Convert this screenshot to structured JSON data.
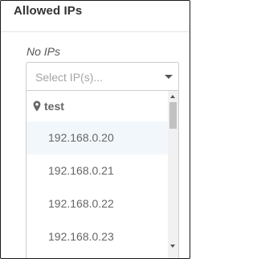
{
  "panel": {
    "title": "Allowed IPs",
    "empty_label": "No IPs"
  },
  "select": {
    "placeholder": "Select IP(s)...",
    "caret_icon": "chevron-down-icon"
  },
  "dropdown": {
    "group": {
      "icon": "map-pin-icon",
      "label": "test"
    },
    "options": [
      {
        "label": "192.168.0.20",
        "highlighted": true
      },
      {
        "label": "192.168.0.21",
        "highlighted": false
      },
      {
        "label": "192.168.0.22",
        "highlighted": false
      },
      {
        "label": "192.168.0.23",
        "highlighted": false
      }
    ]
  },
  "colors": {
    "highlight_bg": "#f2f7fb",
    "text": "#666666",
    "placeholder": "#a5a5a5",
    "border": "#cccccc"
  }
}
